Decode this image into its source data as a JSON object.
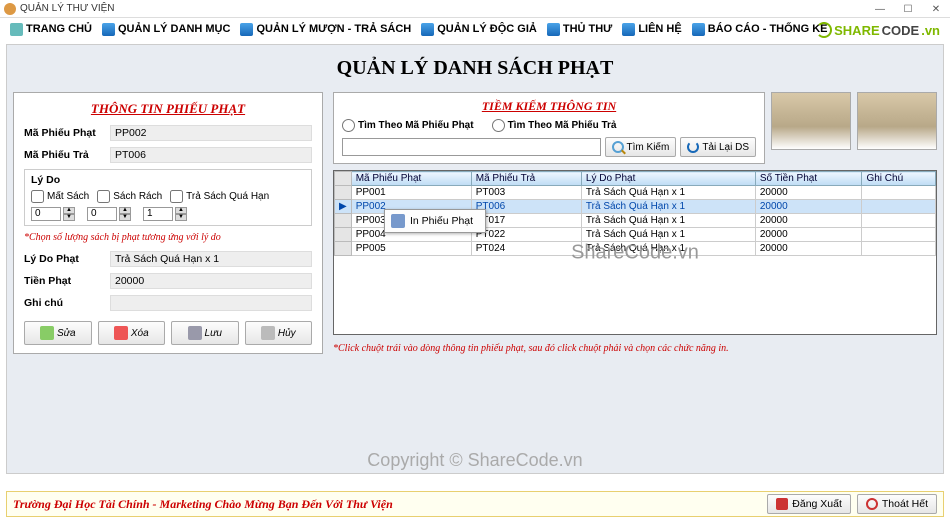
{
  "window_title": "QUẢN LÝ THƯ VIỆN",
  "menu": [
    "TRANG CHỦ",
    "QUẢN LÝ DANH MỤC",
    "QUẢN LÝ MƯỢN - TRẢ SÁCH",
    "QUẢN LÝ ĐỘC GIẢ",
    "THỦ THƯ",
    "LIÊN HỆ",
    "BÁO CÁO - THỐNG KÊ"
  ],
  "logo": {
    "share": "SHARE",
    "code": "CODE",
    "dom": ".vn"
  },
  "page_title": "QUẢN LÝ DANH SÁCH PHẠT",
  "left": {
    "heading": "THÔNG TIN PHIẾU PHẠT",
    "labels": {
      "ma_pp": "Mã Phiếu Phạt",
      "ma_pt": "Mã Phiếu Trả",
      "lydo": "Lý Do",
      "chk1": "Mất Sách",
      "chk2": "Sách Rách",
      "chk3": "Trả Sách Quá Hạn",
      "hint": "*Chọn số lượng sách bị phạt tương ứng với lý do",
      "lydo_phat": "Lý Do Phạt",
      "tien": "Tiền Phạt",
      "ghichu": "Ghi chú"
    },
    "values": {
      "ma_pp": "PP002",
      "ma_pt": "PT006",
      "n1": "0",
      "n2": "0",
      "n3": "1",
      "lydo_phat": "Trả Sách Quá Hạn x 1",
      "tien": "20000",
      "ghichu": ""
    },
    "buttons": {
      "sua": "Sửa",
      "xoa": "Xóa",
      "luu": "Lưu",
      "huy": "Hủy"
    }
  },
  "search": {
    "heading": "TIỀM KIẾM THÔNG TIN",
    "radio1": "Tìm Theo Mã Phiếu Phạt",
    "radio2": "Tìm Theo Mã Phiếu Trả",
    "btn_search": "Tìm Kiếm",
    "btn_reload": "Tải Lại DS"
  },
  "grid": {
    "headers": [
      "Mã Phiếu Phạt",
      "Mã Phiếu Trả",
      "Lý Do Phạt",
      "Số Tiền Phạt",
      "Ghi Chú"
    ],
    "rows": [
      {
        "c": [
          "PP001",
          "PT003",
          "Trả Sách Quá Hạn x 1",
          "20000",
          ""
        ]
      },
      {
        "c": [
          "PP002",
          "PT006",
          "Trả Sách Quá Hạn x 1",
          "20000",
          ""
        ],
        "sel": true
      },
      {
        "c": [
          "PP003",
          "PT017",
          "Trả Sách Quá Hạn x 1",
          "20000",
          ""
        ]
      },
      {
        "c": [
          "PP004",
          "PT022",
          "Trả Sách Quá Hạn x 1",
          "20000",
          ""
        ]
      },
      {
        "c": [
          "PP005",
          "PT024",
          "Trả Sách Quá Hạn x 1",
          "20000",
          ""
        ]
      }
    ],
    "context_menu": "In Phiếu Phạt"
  },
  "note": "*Click chuột trái vào dòng thông tin phiếu phạt, sau đó click chuột phải và chọn các chức năng in.",
  "watermark1": "ShareCode.vn",
  "watermark2": "Copyright © ShareCode.vn",
  "footer": {
    "msg": "Trường Đại Học Tài Chính - Marketing Chào Mừng Bạn Đến Với Thư Viện",
    "logout": "Đăng Xuất",
    "exit": "Thoát Hết"
  }
}
